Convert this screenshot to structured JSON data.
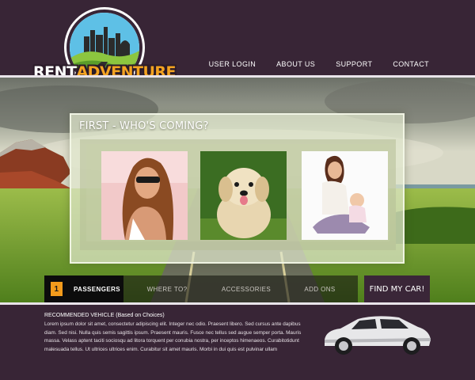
{
  "brand": {
    "name_part1": "RENT",
    "name_part2": "ADVENTURE",
    "accent_color": "#f3a321",
    "background_color": "#382536"
  },
  "nav": {
    "items": [
      {
        "label": "USER LOGIN"
      },
      {
        "label": "ABOUT US"
      },
      {
        "label": "SUPPORT"
      },
      {
        "label": "CONTACT"
      }
    ]
  },
  "panel": {
    "title": "FIRST - WHO'S COMING?",
    "options": [
      {
        "icon": "woman-sunglasses-photo"
      },
      {
        "icon": "puppy-photo"
      },
      {
        "icon": "mother-and-baby-photo"
      }
    ]
  },
  "steps": {
    "active_number": "1",
    "items": [
      {
        "label": "PASSENGERS"
      },
      {
        "label": "WHERE TO?"
      },
      {
        "label": "ACCESSORIES"
      },
      {
        "label": "ADD ONS"
      }
    ],
    "find_button": "FIND MY CAR!"
  },
  "recommendation": {
    "title": "RECOMMENDED VEHICLE (Based on Choices)",
    "body": "Lorem ipsum dolor sit amet, consectetur adipiscing elit. Integer nec odio. Praesent libero. Sed cursus ante dapibus diam. Sed nisi. Nulla quis semis sagittis ipsum. Praesent mauris. Fusce nec tellus sed augue semper porta. Mauris massa. Velass aptent taciti sociosqu ad litora torquent per conubia nostra, per inceptos himenaeos. Curabitotidunt malesuada tellus. Ut ultrices ultrices enim. Curabitur sit amet mauris. Morbi in dui quis est pulvinar ullam",
    "vehicle_icon": "suv-car-image"
  }
}
